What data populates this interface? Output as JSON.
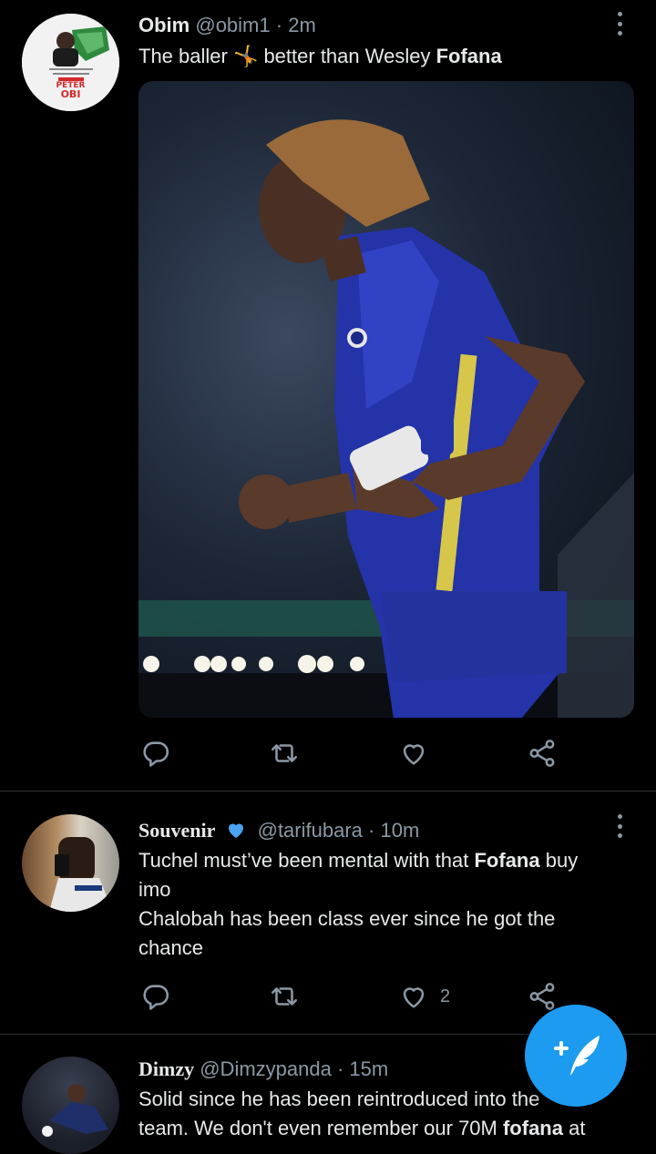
{
  "tweets": [
    {
      "name": "Obim",
      "handle": "@obim1",
      "sep": "·",
      "time": "2m",
      "text_pre": "The baller 🤸 better than Wesley ",
      "text_bold": "Fofana",
      "avatar_text": [
        "PETER",
        "OBI"
      ],
      "replies": "",
      "retweets": "",
      "likes": ""
    },
    {
      "name": "Souvenir",
      "handle": "@tarifubara",
      "sep": "·",
      "time": "10m",
      "verified": true,
      "line1_pre": "Tuchel must’ve been mental with that ",
      "line1_bold": "Fofana",
      "line1_post": " buy",
      "line2": "imo",
      "line3": "Chalobah has been class ever since he got the",
      "line4": "chance",
      "likes": "2"
    },
    {
      "name": "Dimzy",
      "handle": "@Dimzypanda",
      "sep": "·",
      "time": "15m",
      "line1": "Solid since he has been reintroduced into the",
      "line2_pre": "team. We don't even remember our 70M ",
      "line2_bold": "fofana",
      "line2_post": " at"
    }
  ],
  "icons": [
    "reply-icon",
    "retweet-icon",
    "like-icon",
    "share-icon",
    "compose-tweet-icon",
    "verified-badge-icon",
    "more-options-icon"
  ],
  "colors": {
    "accent": "#1d9bf0",
    "muted": "#8b98a5",
    "background": "#000000"
  }
}
